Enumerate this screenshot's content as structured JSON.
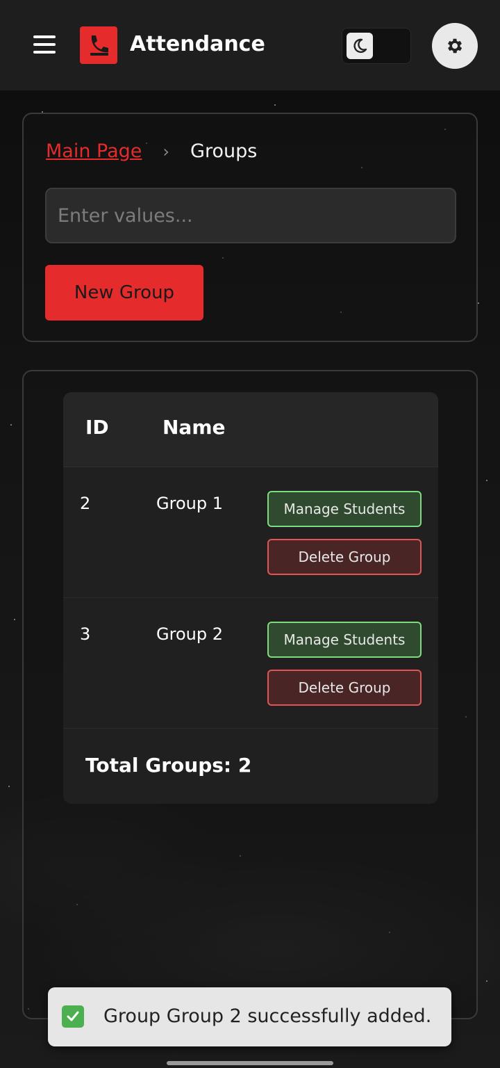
{
  "app": {
    "title": "Attendance"
  },
  "breadcrumb": {
    "home": "Main Page",
    "separator": "›",
    "current": "Groups"
  },
  "search": {
    "placeholder": "Enter values...",
    "value": ""
  },
  "actions": {
    "new_group": "New Group"
  },
  "table": {
    "headers": {
      "id": "ID",
      "name": "Name"
    },
    "rows": [
      {
        "id": "2",
        "name": "Group 1",
        "manage": "Manage Students",
        "delete": "Delete Group"
      },
      {
        "id": "3",
        "name": "Group 2",
        "manage": "Manage Students",
        "delete": "Delete Group"
      }
    ],
    "footer": "Total Groups: 2"
  },
  "toast": {
    "message": "Group Group 2 successfully added."
  },
  "colors": {
    "accent": "#e52b2b",
    "manage_border": "#7ddc7d",
    "delete_border": "#e35454"
  },
  "icons": {
    "menu": "hamburger-menu-icon",
    "logo": "attendance-logo-icon",
    "theme": "moon-icon",
    "settings": "gear-icon",
    "toast": "check-mark-icon"
  }
}
